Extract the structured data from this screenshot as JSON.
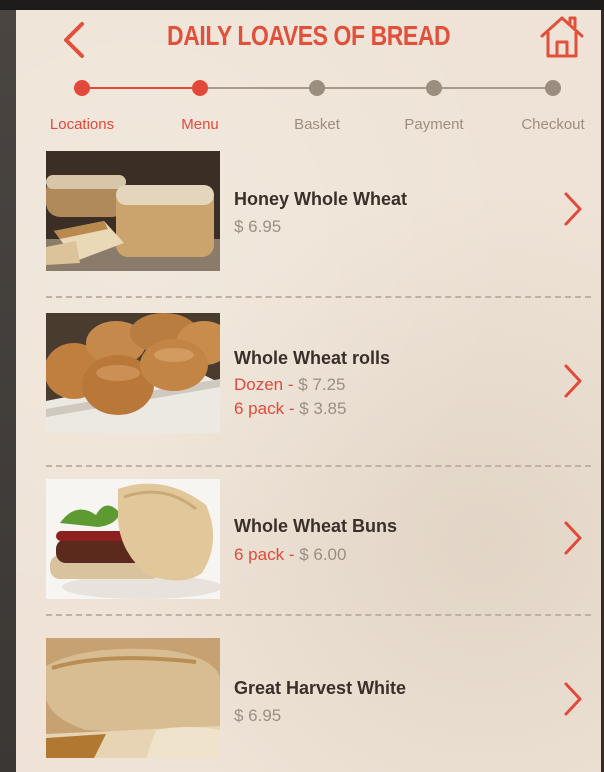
{
  "header": {
    "title": "DAILY LOAVES OF BREAD"
  },
  "steps": [
    "Locations",
    "Menu",
    "Basket",
    "Payment",
    "Checkout"
  ],
  "colors": {
    "accent": "#e3493a",
    "inactive": "#9c8e7f",
    "text": "#3a302a"
  },
  "products": [
    {
      "name": "Honey Whole Wheat",
      "price": "$ 6.95"
    },
    {
      "name": "Whole Wheat rolls",
      "options": [
        {
          "label": "Dozen",
          "price": "$ 7.25"
        },
        {
          "label": "6 pack",
          "price": "$ 3.85"
        }
      ]
    },
    {
      "name": "Whole Wheat Buns",
      "options": [
        {
          "label": "6 pack",
          "price": "$ 6.00"
        }
      ]
    },
    {
      "name": "Great Harvest White",
      "price": "$ 6.95"
    }
  ],
  "icons": {
    "back": "chevron-left-icon",
    "home": "home-icon",
    "row": "chevron-right-icon"
  }
}
